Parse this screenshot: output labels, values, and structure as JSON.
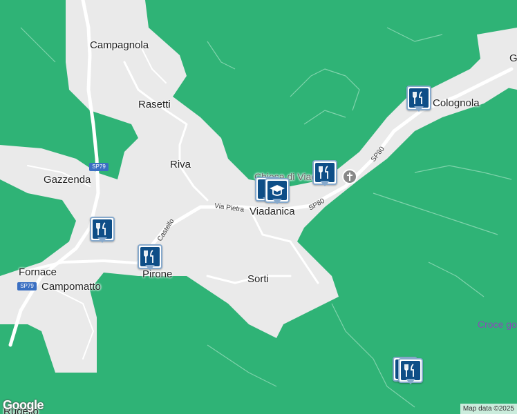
{
  "map": {
    "places": [
      {
        "name": "Campagnola"
      },
      {
        "name": "Rasetti"
      },
      {
        "name": "Riva"
      },
      {
        "name": "Gazzenda"
      },
      {
        "name": "Viadanica"
      },
      {
        "name": "Colognola"
      },
      {
        "name": "Fornace"
      },
      {
        "name": "Campomatto"
      },
      {
        "name": "Pirone"
      },
      {
        "name": "Sorti"
      },
      {
        "name": "Chiesa di Viad"
      },
      {
        "name": "Croce go"
      },
      {
        "name": "G"
      },
      {
        "name": "Rudello"
      }
    ],
    "roads": [
      "Via Pietra",
      "Castello",
      "SP80",
      "SP80"
    ],
    "shields": [
      "SP79",
      "SP79"
    ],
    "markers": [
      {
        "icon": "restaurant-icon"
      },
      {
        "icon": "restaurant-icon"
      },
      {
        "icon": "restaurant-icon"
      },
      {
        "icon": "restaurant-icon"
      },
      {
        "icon": "restaurant-icon"
      },
      {
        "icon": "school-icon"
      },
      {
        "icon": "school-icon"
      }
    ],
    "colors": {
      "forest": "#2fb376",
      "urban": "#eaeaea",
      "road": "#ffffff",
      "marker": "#0e4e87"
    }
  },
  "footer": {
    "logo": "Google",
    "attribution": "Map data ©2025"
  }
}
